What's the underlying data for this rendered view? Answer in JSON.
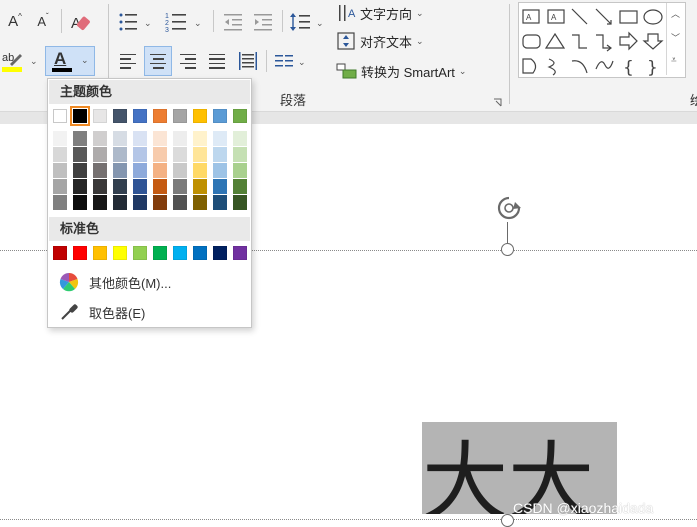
{
  "ribbon": {
    "font_grow": "A",
    "font_shrink": "A",
    "font_color_letter": "A",
    "highlight_letter": "ab",
    "text_direction": "文字方向",
    "align_text": "对齐文本",
    "convert_smartart": "转换为 SmartArt",
    "paragraph_group_label": "段落",
    "cut_off_label": "绘"
  },
  "menu": {
    "theme_header": "主题颜色",
    "standard_header": "标准色",
    "more_colors": "其他颜色(M)...",
    "eyedropper": "取色器(E)",
    "theme_top_row": [
      "#FFFFFF",
      "#000000",
      "#E7E6E6",
      "#44546A",
      "#4472C4",
      "#ED7D31",
      "#A5A5A5",
      "#FFC000",
      "#5B9BD5",
      "#70AD47"
    ],
    "theme_shades": [
      [
        "#F2F2F2",
        "#7F7F7F",
        "#D0CECE",
        "#D6DCE4",
        "#D9E2F3",
        "#FBE5D5",
        "#EDEDED",
        "#FFF2CC",
        "#DEEAF6",
        "#E2EFD9"
      ],
      [
        "#D8D8D8",
        "#595959",
        "#AEABAB",
        "#ADB9CA",
        "#B4C6E7",
        "#F7CBAC",
        "#DBDBDB",
        "#FFE599",
        "#BDD7EE",
        "#C5E0B3"
      ],
      [
        "#BFBFBF",
        "#3F3F3F",
        "#757070",
        "#8496B0",
        "#8EAADB",
        "#F4B183",
        "#C9C9C9",
        "#FFD966",
        "#9DC3E6",
        "#A8D08D"
      ],
      [
        "#A5A5A5",
        "#262626",
        "#3A3838",
        "#323F4F",
        "#2F5496",
        "#C55A11",
        "#7B7B7B",
        "#BF9000",
        "#2E75B5",
        "#538135"
      ],
      [
        "#7F7F7F",
        "#0C0C0C",
        "#171616",
        "#222A35",
        "#1F3864",
        "#833C0B",
        "#525252",
        "#7F6000",
        "#1E4E79",
        "#375623"
      ]
    ],
    "standard_colors": [
      "#C00000",
      "#FF0000",
      "#FFC000",
      "#FFFF00",
      "#92D050",
      "#00B050",
      "#00B0F0",
      "#0070C0",
      "#002060",
      "#7030A0"
    ]
  },
  "canvas": {
    "textbox_text": "大大",
    "watermark": "CSDN @xiaozhaidada"
  }
}
